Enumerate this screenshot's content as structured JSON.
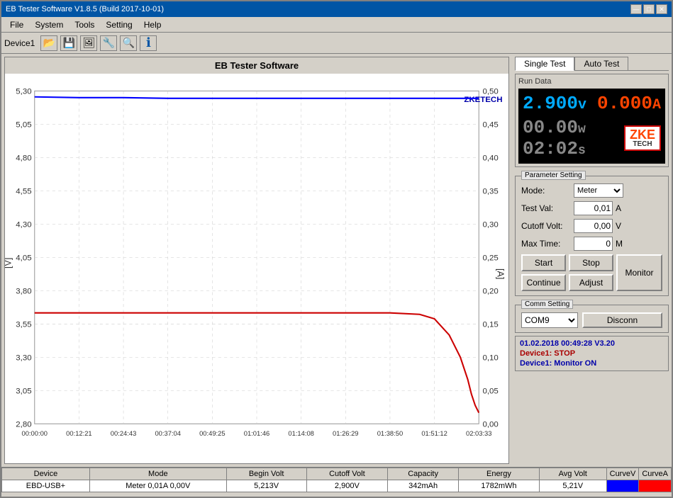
{
  "window": {
    "title": "EB Tester Software V1.8.5 (Build 2017-10-01)"
  },
  "title_buttons": {
    "minimize": "—",
    "maximize": "□",
    "close": "✕"
  },
  "menu": {
    "items": [
      "File",
      "System",
      "Tools",
      "Setting",
      "Help"
    ]
  },
  "toolbar": {
    "device_label": "Device1"
  },
  "chart": {
    "title": "EB Tester Software",
    "y_left_label": "[V]",
    "y_right_label": "[A]",
    "y_left_values": [
      "5,30",
      "5,05",
      "4,80",
      "4,55",
      "4,30",
      "4,05",
      "3,80",
      "3,55",
      "3,30",
      "3,05",
      "2,80"
    ],
    "y_right_values": [
      "0,50",
      "0,45",
      "0,40",
      "0,35",
      "0,30",
      "0,25",
      "0,20",
      "0,15",
      "0,10",
      "0,05",
      "0,00"
    ],
    "x_values": [
      "00:00:00",
      "00:12:21",
      "00:24:43",
      "00:37:04",
      "00:49:25",
      "01:01:46",
      "01:14:08",
      "01:26:29",
      "01:38:50",
      "01:51:12",
      "02:03:33"
    ]
  },
  "tabs": {
    "single_test": "Single Test",
    "auto_test": "Auto Test"
  },
  "run_data": {
    "label": "Run Data",
    "voltage": "2.900",
    "voltage_unit": "v",
    "current": "0.000",
    "current_unit": "A",
    "power": "00.00",
    "power_unit": "w",
    "time": "02:02",
    "time_unit": "s",
    "zke_line1": "ZKE",
    "zke_line2": "TECH"
  },
  "params": {
    "title": "Parameter Setting",
    "mode_label": "Mode:",
    "mode_value": "Meter",
    "test_val_label": "Test Val:",
    "test_val_value": "0,01",
    "test_val_unit": "A",
    "cutoff_volt_label": "Cutoff Volt:",
    "cutoff_volt_value": "0,00",
    "cutoff_volt_unit": "V",
    "max_time_label": "Max Time:",
    "max_time_value": "0",
    "max_time_unit": "M"
  },
  "buttons": {
    "start": "Start",
    "stop": "Stop",
    "continue": "Continue",
    "adjust": "Adjust",
    "monitor": "Monitor"
  },
  "comm": {
    "title": "Comm Setting",
    "port": "COM9",
    "disconnect": "Disconn"
  },
  "status": {
    "line1": "01.02.2018 00:49:28  V3.20",
    "line2": "Device1: STOP",
    "line3": "Device1: Monitor ON"
  },
  "table": {
    "headers": [
      "Device",
      "Mode",
      "Begin Volt",
      "Cutoff Volt",
      "Capacity",
      "Energy",
      "Avg Volt",
      "CurveV",
      "CurveA"
    ],
    "row": {
      "device": "EBD-USB+",
      "mode": "Meter 0,01A 0,00V",
      "begin_volt": "5,213V",
      "cutoff_volt": "2,900V",
      "capacity": "342mAh",
      "energy": "1782mWh",
      "avg_volt": "5,21V",
      "curve_v": "",
      "curve_a": ""
    }
  }
}
